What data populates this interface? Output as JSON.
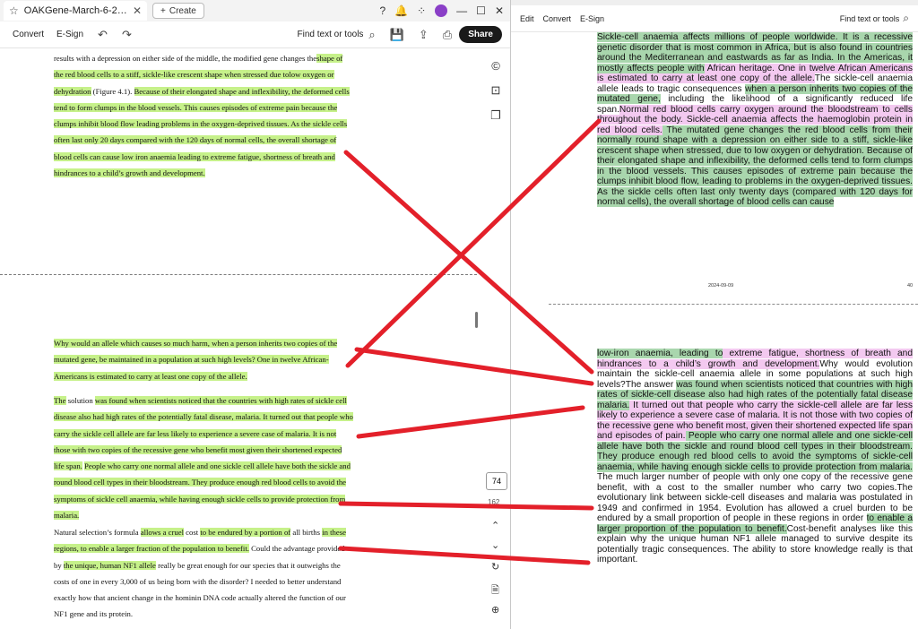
{
  "left": {
    "tab_title": "OAKGene-March-6-202...",
    "create_label": "Create",
    "toolbar": {
      "convert": "Convert",
      "esign": "E-Sign",
      "find": "Find text or tools",
      "share": "Share"
    },
    "page_number": "74",
    "page_total": "162",
    "top_para": [
      {
        "t": "results with a depression on either side of the middle, the modified gene changes the",
        "h": false
      },
      {
        "t": "shape of the red blood cells to a stiff, sickle-like crescent shape when stressed due to",
        "h": true
      },
      {
        "t": "low oxygen or dehydration",
        "h": true
      },
      {
        "t": " (Figure 4.1). ",
        "h": false
      },
      {
        "t": "Because of their elongated shape and inflexibility, the deformed cells tend to form clumps in the blood vessels. This causes episodes of extreme pain because the clumps inhibit blood flow leading problems in the oxygen-deprived tissues. As the sickle cells often last only 20 days compared with the 120 days of normal cells, the overall shortage of blood cells can cause low iron anaemia leading to extreme fatigue, shortness of breath and hindrances to a child’s growth and development.",
        "h": true
      }
    ],
    "p1": [
      {
        "t": "Why would an allele which causes so much harm, when a person inherits two copies of the mutated gene, be maintained in a population at such high levels? One in twelve African-Americans is estimated to carry at least one copy of the allele.",
        "h": true
      }
    ],
    "p2": [
      {
        "t": "The",
        "h": true
      },
      {
        "t": " solution ",
        "h": false
      },
      {
        "t": "was found when scientists noticed that the countries with high rates of sickle cell disease also had high rates of the potentially fatal disease, malaria. It turned out that people who carry the sickle cell allele are far less likely to experience a severe case of malaria. It is not those with two copies of the recessive gene who benefit most given their shortened expected life span.",
        "h": true
      },
      {
        "t": " ",
        "h": false
      },
      {
        "t": "People who carry one normal allele and one sickle cell allele have both the sickle and round blood cell types in their bloodstream. They produce enough red blood cells to avoid the symptoms of sickle cell anaemia, while having enough sickle cells to provide protection from malaria.",
        "h": true
      }
    ],
    "p3": [
      {
        "t": "Natural selection’s formula ",
        "h": false
      },
      {
        "t": "allows a cruel",
        "h": true
      },
      {
        "t": " cost ",
        "h": false
      },
      {
        "t": "to be endured by a portion of",
        "h": true
      },
      {
        "t": " all births ",
        "h": false
      },
      {
        "t": "in these regions, to enable a larger fraction of the population to benefit.",
        "h": true
      },
      {
        "t": " Could the advantage provided by ",
        "h": false
      },
      {
        "t": "the unique, human NF1 allele",
        "h": true
      },
      {
        "t": " really be great enough for our species that it outweighs the costs of one in every 3,000 of us being born with the disorder? I needed to better understand exactly how that ancient change in the hominin DNA code actually altered the function of our NF1 gene and its protein.",
        "h": false
      }
    ]
  },
  "right": {
    "toolbar": {
      "edit": "Edit",
      "convert": "Convert",
      "esign": "E-Sign",
      "find": "Find text or tools"
    },
    "footer_date": "2024-09-09",
    "footer_page": "40",
    "page_a": [
      {
        "t": "Sickle-cell anaemia affects millions of people worldwide. It is a recessive genetic disorder that is most common in Africa, but is also found in countries around the Mediterranean and eastwards as far as India. In the Americas, it mostly affects people with",
        "c": "g"
      },
      {
        "t": " African heritage. One in twelve African Americans is estimated to carry at least one copy of the allele.",
        "c": "p"
      },
      {
        "t": "The sickle-cell anaemia allele leads to tragic consequences ",
        "c": ""
      },
      {
        "t": "when a person inherits two copies of the mutated gene,",
        "c": "g"
      },
      {
        "t": " including the likelihood of a significantly reduced life span.",
        "c": ""
      },
      {
        "t": "Normal red blood cells carry oxygen around the bloodstream to cells throughout the body. Sickle-cell anaemia affects the haemoglobin protein in red blood cells.",
        "c": "p"
      },
      {
        "t": " The mutated gene changes the red blood cells from their normally round shape with a depression on either side to a stiff, sickle-like crescent shape when stressed, due to low oxygen or dehydration. Because of their elongated shape and inflexibility, the deformed cells tend to form clumps in the blood vessels. This causes episodes of extreme pain because the clumps inhibit blood flow, leading to problems in the oxygen-deprived tissues. As the sickle cells often last only twenty days (compared with 120 days for normal cells), the overall shortage of blood cells can cause",
        "c": "g"
      }
    ],
    "page_b": [
      {
        "t": "low-iron anaemia, leading to",
        "c": "g"
      },
      {
        "t": " extreme fatigue, shortness of breath and hindrances to a child’s growth and development.",
        "c": "p"
      },
      {
        "t": "Why would evolution maintain the sickle-cell anaemia allele in some populations at such high levels?",
        "c": ""
      },
      {
        "t": "The answer ",
        "c": ""
      },
      {
        "t": "was found when scientists noticed that countries with high rates of sickle-cell disease also had high rates of the potentially fatal disease malaria.",
        "c": "g"
      },
      {
        "t": " It turned out that people who carry the sickle-cell allele are far less likely to experience a severe case of malaria. It is not those with two copies of the recessive gene who benefit most, given their shortened expected life span and episodes of pain.",
        "c": "p"
      },
      {
        "t": " People who carry one normal allele and one sickle-cell allele have both the sickle and round blood cell types in their bloodstream. They produce enough red blood cells to avoid the symptoms of sickle-cell anaemia, while having enough sickle cells to provide protection from malaria.",
        "c": "g"
      },
      {
        "t": " The much larger number of people with only one copy of the recessive gene benefit, with a cost to the smaller number who carry two copies.",
        "c": ""
      },
      {
        "t": "The evolutionary link between sickle-cell diseases and malaria was postulated in 1949 and confirmed in 1954.",
        "c": ""
      },
      {
        "t": " Evolution has allowed a cruel burden to be endured by a small proportion of people in these regions in order ",
        "c": ""
      },
      {
        "t": "to enable a larger proportion of the population to benefit.",
        "c": "g"
      },
      {
        "t": "Cost-benefit analyses like this explain why the unique human NF1 allele managed to survive despite its potentially tragic consequences. The ability to store knowledge really is that important.",
        "c": ""
      }
    ]
  },
  "colors": {
    "annotation_red": "#e3202a",
    "left_highlight": "#c6f18a",
    "right_green": "#a9d6ad",
    "right_pink": "#f3c9f0"
  }
}
